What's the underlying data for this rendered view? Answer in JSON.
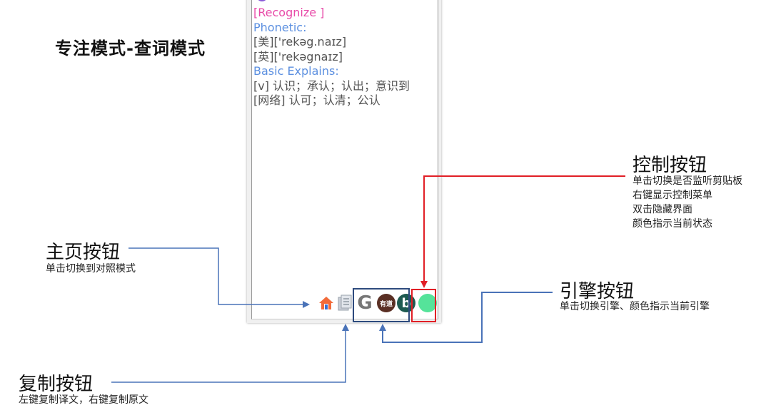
{
  "heading": "专注模式-查词模式",
  "dictionary": {
    "word": "[Recognize ]",
    "phonetic_label": "Phonetic:",
    "phonetic_us": "[美]['rekəg.naɪz]",
    "phonetic_uk": "[英]['rekəgnaɪz]",
    "basic_label": "Basic Explains:",
    "explain_1": "[v] 认识；承认；认出；意识到",
    "explain_2": "[网络] 认可；认清；公认"
  },
  "toolbar": {
    "google_glyph": "G",
    "youdao_glyph": "有道",
    "bing_glyph": "b"
  },
  "icons": {
    "home": "home-icon",
    "copy": "copy-icon",
    "google": "google-icon",
    "youdao": "youdao-icon",
    "bing": "bing-icon",
    "control": "control-icon"
  },
  "annotations": {
    "control": {
      "title": "控制按钮",
      "lines": [
        "单击切换是否监听剪贴板",
        "右键显示控制菜单",
        "双击隐藏界面",
        "颜色指示当前状态"
      ]
    },
    "home": {
      "title": "主页按钮",
      "lines": [
        "单击切换到对照模式"
      ]
    },
    "engine": {
      "title": "引擎按钮",
      "lines": [
        "单击切换引擎、颜色指示当前引擎"
      ]
    },
    "copy": {
      "title": "复制按钮",
      "lines": [
        "左键复制译文，右键复制原文"
      ]
    }
  },
  "colors": {
    "word": "#e84aa8",
    "label": "#5b8fe0",
    "control_active": "#55e39a",
    "arrow_blue": "#4a73b8",
    "arrow_red": "#e11f26"
  }
}
